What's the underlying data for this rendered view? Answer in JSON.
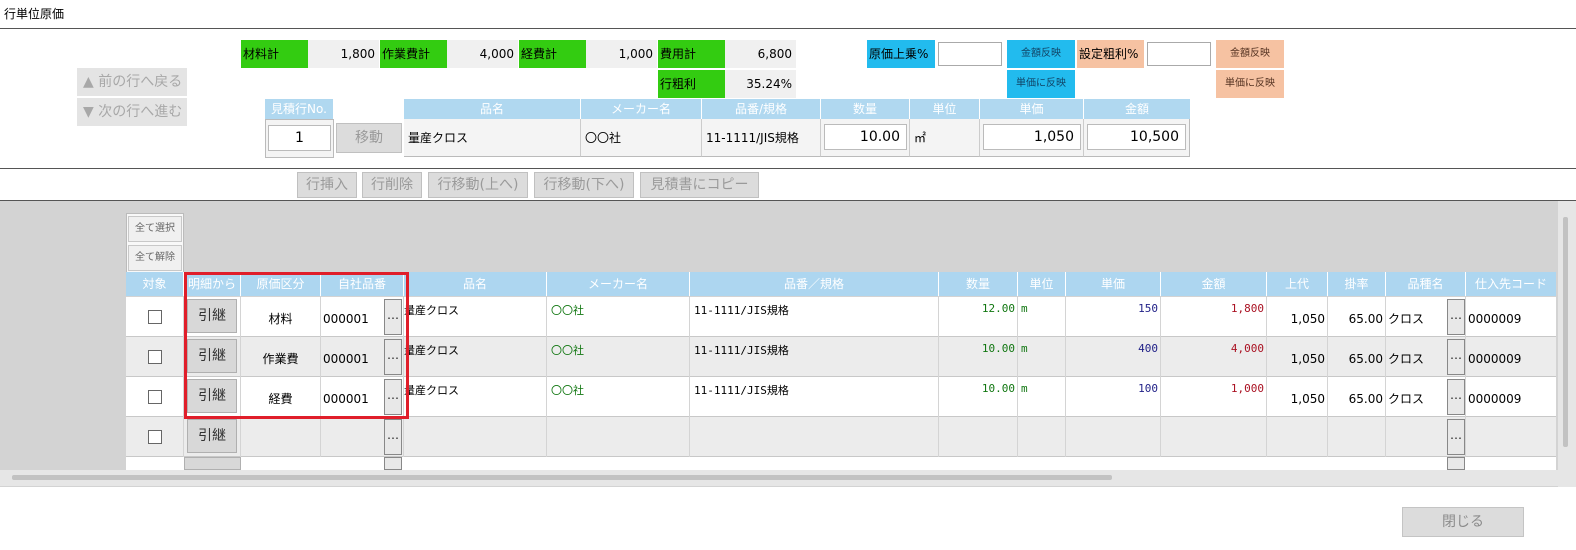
{
  "window": {
    "title": "行単位原価"
  },
  "summary": {
    "material_label": "材料計",
    "material_value": "1,800",
    "work_label": "作業費計",
    "work_value": "4,000",
    "expense_label": "経費計",
    "expense_value": "1,000",
    "cost_label": "費用計",
    "cost_value": "6,800",
    "gross_label": "行粗利",
    "gross_value": "35.24%",
    "markup_label": "原価上乗%",
    "markup_value": "",
    "markup_amount_btn": "金額反映",
    "markup_unit_btn": "単価に反映",
    "margin_label": "設定粗利%",
    "margin_value": "",
    "margin_amount_btn": "金額反映",
    "margin_unit_btn": "単価に反映"
  },
  "nav": {
    "prev": "▲ 前の行へ戻る",
    "next": "▼ 次の行へ進む"
  },
  "estimate_line": {
    "no_label": "見積行No.",
    "no_value": "1",
    "move_btn": "移動",
    "headers": [
      "品名",
      "メーカー名",
      "品番/規格",
      "数量",
      "単位",
      "単価",
      "金額"
    ],
    "name": "量産クロス",
    "maker": "〇〇社",
    "spec": "11-1111/JIS規格",
    "qty": "10.00",
    "unit": "㎡",
    "price": "1,050",
    "amount": "10,500"
  },
  "toolbar": {
    "insert": "行挿入",
    "delete": "行削除",
    "move_up": "行移動(上へ)",
    "move_down": "行移動(下へ)",
    "copy": "見積書にコピー"
  },
  "grid": {
    "select_all": "全て選択",
    "deselect_all": "全て解除",
    "headers": [
      "対象",
      "明細から",
      "原価区分",
      "自社品番",
      "品名",
      "メーカー名",
      "品番／規格",
      "数量",
      "単位",
      "単価",
      "金額",
      "上代",
      "掛率",
      "品種名",
      "仕入先コード"
    ],
    "inherit_label": "引継",
    "ellipsis": "…",
    "rows": [
      {
        "category": "材料",
        "code": "000001",
        "name": "量産クロス",
        "maker": "〇〇社",
        "spec": "11-1111/JIS規格",
        "qty": "12.00",
        "unit": "m",
        "price": "150",
        "amount": "1,800",
        "retail": "1,050",
        "rate": "65.00",
        "kind": "クロス",
        "supplier": "0000009"
      },
      {
        "category": "作業費",
        "code": "000001",
        "name": "量産クロス",
        "maker": "〇〇社",
        "spec": "11-1111/JIS規格",
        "qty": "10.00",
        "unit": "m",
        "price": "400",
        "amount": "4,000",
        "retail": "1,050",
        "rate": "65.00",
        "kind": "クロス",
        "supplier": "0000009"
      },
      {
        "category": "経費",
        "code": "000001",
        "name": "量産クロス",
        "maker": "〇〇社",
        "spec": "11-1111/JIS規格",
        "qty": "10.00",
        "unit": "m",
        "price": "100",
        "amount": "1,000",
        "retail": "1,050",
        "rate": "65.00",
        "kind": "クロス",
        "supplier": "0000009"
      }
    ]
  },
  "footer": {
    "close": "閉じる"
  }
}
